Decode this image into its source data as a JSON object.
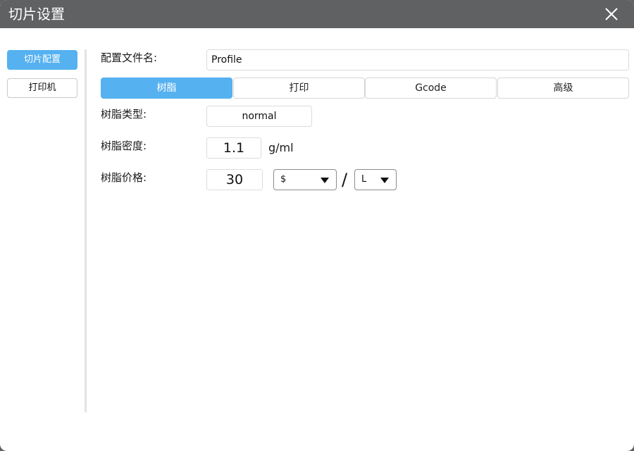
{
  "window": {
    "title": "切片设置"
  },
  "sidebar": {
    "items": [
      {
        "label": "切片配置",
        "active": true
      },
      {
        "label": "打印机",
        "active": false
      }
    ]
  },
  "profile": {
    "label": "配置文件名:",
    "value": "Profile"
  },
  "tabs": [
    {
      "label": "树脂",
      "active": true
    },
    {
      "label": "打印",
      "active": false
    },
    {
      "label": "Gcode",
      "active": false
    },
    {
      "label": "高级",
      "active": false
    }
  ],
  "resin": {
    "type_label": "树脂类型:",
    "type_value": "normal",
    "density_label": "树脂密度:",
    "density_value": "1.1",
    "density_unit": "g/ml",
    "price_label": "树脂价格:",
    "price_value": "30",
    "currency": "$",
    "separator": "/",
    "volume_unit": "L"
  },
  "colors": {
    "accent": "#56b1f0",
    "titlebar": "#5f6163"
  }
}
